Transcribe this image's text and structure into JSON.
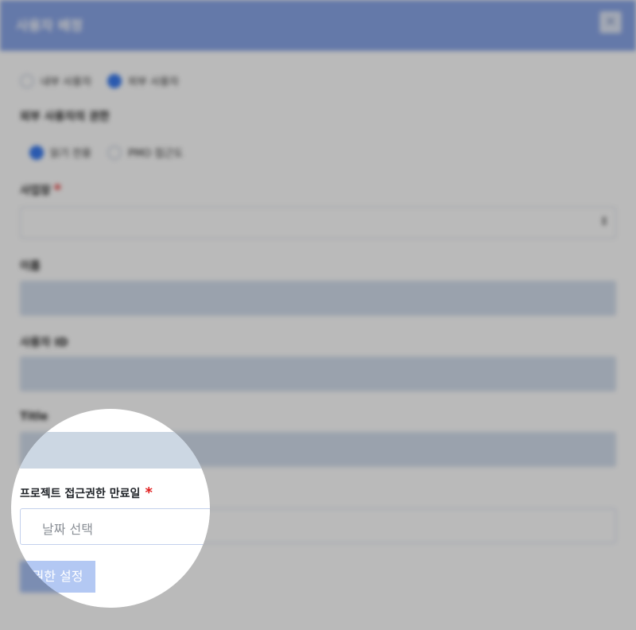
{
  "dialog": {
    "title": "사용자 배정",
    "close_icon": "close-icon",
    "colors": {
      "header": "#8aa6e8",
      "accent": "#3b7cf0",
      "required": "#e11d1d"
    }
  },
  "user_type": {
    "options": [
      "내부 사용자",
      "외부 사용자"
    ],
    "selected": "외부 사용자"
  },
  "auth_section": {
    "label": "외부 사용자의 권한",
    "options": [
      "읽기 전용",
      "PMO 접근도"
    ],
    "selected": "읽기 전용"
  },
  "company": {
    "label": "사업장",
    "required_mark": "*",
    "value": ""
  },
  "name": {
    "label": "이름",
    "value": ""
  },
  "username": {
    "label": "사용자 ID",
    "value": ""
  },
  "title": {
    "label": "Title",
    "value": ""
  },
  "access_expiry": {
    "label": "프로젝트 접근권한 만료일",
    "required_mark": "*",
    "placeholder": "날짜 선택"
  },
  "apply_button": {
    "label": "권한 설정",
    "visible_label": "권한 설정"
  }
}
